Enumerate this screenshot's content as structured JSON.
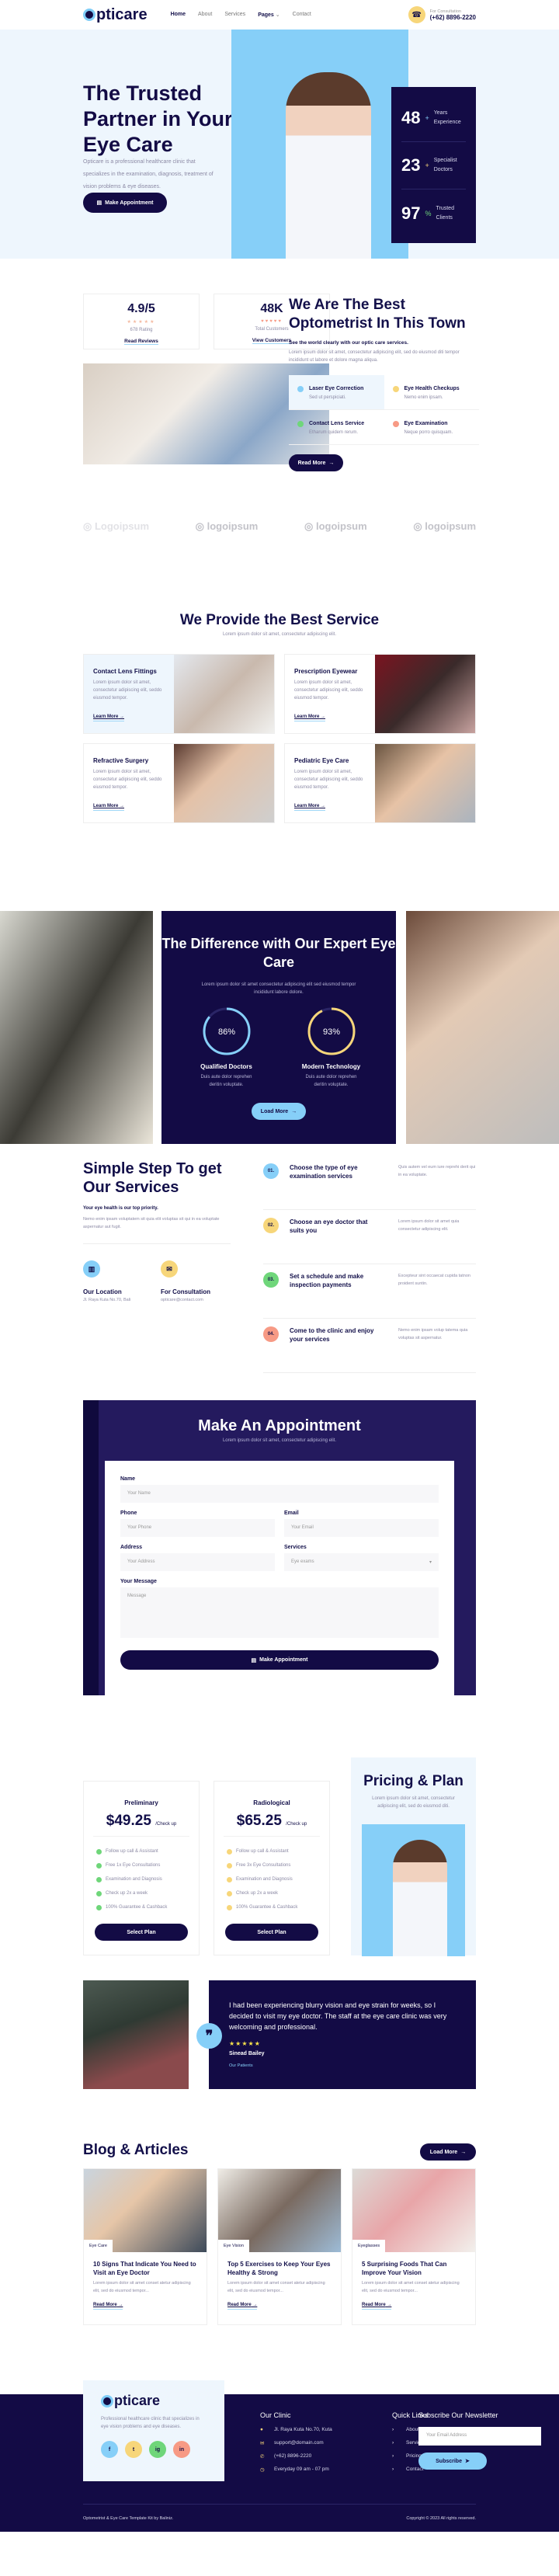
{
  "brand": {
    "logo": "pticare",
    "colors": {
      "navy": "#130b45",
      "sky": "#86cff8",
      "yellow": "#f7d67a",
      "green": "#6fd67a",
      "coral": "#f79a85",
      "light": "#eef6fd"
    }
  },
  "nav": {
    "items": [
      "Home",
      "About",
      "Services",
      "Pages",
      "Contact"
    ],
    "consult_label": "For Consultation",
    "phone": "(+62) 8896-2220"
  },
  "hero": {
    "title": "The Trusted Partner in Your Eye Care",
    "description": "Opticare is a professional healthcare clinic that specializes in the examination, diagnosis, treatment of vision problems & eye diseases.",
    "button": "Make Appointment",
    "stats": [
      {
        "value": "48",
        "suffix": "+",
        "label": "Years Experience"
      },
      {
        "value": "23",
        "suffix": "+",
        "label": "Specialist Doctors"
      },
      {
        "value": "97",
        "suffix": "%",
        "label": "Trusted Clients"
      }
    ]
  },
  "about": {
    "cards": [
      {
        "value": "4.9/5",
        "stars": 5,
        "caption": "678 Rating",
        "link": "Read Reviews"
      },
      {
        "value": "48K",
        "stars": 5,
        "caption": "Total Customers",
        "link": "View Customers"
      }
    ],
    "title": "We Are The Best Optometrist In This Town",
    "subtitle": "See the world clearly with our optic care services.",
    "description": "Lorem ipsum dolor sit amet, consectetur adipiscing elit, sed do eiusmod diti tempor incididunt ut labore et dolore magna aliqua.",
    "features": [
      {
        "title": "Laser Eye Correction",
        "text": "Sed ut perspiciati."
      },
      {
        "title": "Eye Health Checkups",
        "text": "Nemo enim ipsam."
      },
      {
        "title": "Contact Lens Service",
        "text": "Etharum quidem rerum."
      },
      {
        "title": "Eye Examination",
        "text": "Neque porro quisquam."
      }
    ],
    "button": "Read More"
  },
  "logos": [
    "Logoipsum",
    "logoipsum",
    "logoipsum",
    "logoipsum"
  ],
  "services": {
    "title": "We Provide the Best Service",
    "subtitle": "Lorem ipsum dolor sit amet, consectetur adipiscing elit.",
    "items": [
      {
        "title": "Contact Lens Fittings",
        "text": "Lorem ipsum dolor sit amet, consectetur adipiscing elit, seddo eiusmod tempor.",
        "link": "Learn More"
      },
      {
        "title": "Prescription Eyewear",
        "text": "Lorem ipsum dolor sit amet, consectetur adipiscing elit, seddo eiusmod tempor.",
        "link": "Learn More"
      },
      {
        "title": "Refractive Surgery",
        "text": "Lorem ipsum dolor sit amet, consectetur adipiscing elit, seddo eiusmod tempor.",
        "link": "Learn More"
      },
      {
        "title": "Pediatric Eye Care",
        "text": "Lorem ipsum dolor sit amet, consectetur adipiscing elit, seddo eiusmod tempor.",
        "link": "Learn More"
      }
    ]
  },
  "difference": {
    "title": "The Difference with Our Expert Eye Care",
    "description": "Lorem ipsum dolor sit amet consectetur adipiscing elit sed eiusmod tempor incididunt labore dolore.",
    "metrics": [
      {
        "percent": 86,
        "label": "86%",
        "title": "Qualified Doctors",
        "text": "Duis aute dolor reprehen deritin voluptate."
      },
      {
        "percent": 93,
        "label": "93%",
        "title": "Modern Technology",
        "text": "Duis aute dolor reprehen deritin voluptate."
      }
    ],
    "button": "Load More"
  },
  "steps": {
    "title": "Simple Step To get Our Services",
    "subtitle": "Your eye health is our top priority.",
    "description": "Nemo enim ipsam voluptatem sit quia elit voluptas sit qui in ea voluptate aspernatur aut fugit.",
    "location": {
      "title": "Our Location",
      "text": "Jl. Raya Kuta No.70, Bali"
    },
    "consult": {
      "title": "For Consultation",
      "text": "opticare@contact.com"
    },
    "items": [
      {
        "num": "01.",
        "title": "Choose the type of eye examination services",
        "text": "Quis autem vel eum iure reprehi derit qui in ea voluptate."
      },
      {
        "num": "02.",
        "title": "Choose an eye doctor that suits you",
        "text": "Lorem ipsum dolor sit amet quia consectetur adipiscing elit."
      },
      {
        "num": "03.",
        "title": "Set a schedule and make inspection payments",
        "text": "Excepteur sint occaecat cupida tatnon proident suntin."
      },
      {
        "num": "04.",
        "title": "Come to the clinic and enjoy your services",
        "text": "Nemo enim ipsam volup tatema quia voluptas sit aspernatur."
      }
    ]
  },
  "appointment": {
    "title": "Make An Appointment",
    "subtitle": "Lorem ipsum dolor sit amet, consectetur adipiscing elit.",
    "fields": {
      "name": {
        "label": "Name",
        "placeholder": "Your Name"
      },
      "phone": {
        "label": "Phone",
        "placeholder": "Your Phone"
      },
      "email": {
        "label": "Email",
        "placeholder": "Your Email"
      },
      "address": {
        "label": "Address",
        "placeholder": "Your Address"
      },
      "services": {
        "label": "Services",
        "value": "Eye exams"
      },
      "message": {
        "label": "Your Message",
        "placeholder": "Message"
      }
    },
    "button": "Make Appointment"
  },
  "pricing": {
    "title": "Pricing & Plan",
    "description": "Lorem ipsum dolor sit amet, consectetur adipiscing elit, sed do eiusmod diti.",
    "plans": [
      {
        "name": "Preliminary",
        "price": "$49.25",
        "unit": "/Check up",
        "features": [
          "Follow up call & Assistant",
          "Free 1x Eye Consultations",
          "Examination and Diagnosis",
          "Check up 2x a week",
          "100% Guarantee & Cashback"
        ],
        "button": "Select Plan"
      },
      {
        "name": "Radiological",
        "price": "$65.25",
        "unit": "/Check up",
        "features": [
          "Follow up call & Assistant",
          "Free 3x Eye Consultations",
          "Examination and Diagnosis",
          "Check up 2x a week",
          "100% Guarantee & Cashback"
        ],
        "button": "Select Plan"
      }
    ]
  },
  "testimonial": {
    "quote": "I had been experiencing blurry vision and eye strain for weeks, so I decided to visit my eye doctor. The staff at the eye care clinic was very welcoming and professional.",
    "rating": 5,
    "name": "Sinead Bailey",
    "role": "Our Patients"
  },
  "blog": {
    "title": "Blog & Articles",
    "button": "Load More",
    "posts": [
      {
        "tag": "Eye Care",
        "title": "10 Signs That Indicate You Need to Visit an Eye Doctor",
        "excerpt": "Lorem ipsum dolor sit amet conset atetur adipiscing elit, sed do eiusmod tempor...",
        "link": "Read More"
      },
      {
        "tag": "Eye Vision",
        "title": "Top 5 Exercises to Keep Your Eyes Healthy & Strong",
        "excerpt": "Lorem ipsum dolor sit amet conset atetur adipiscing elit, sed do eiusmod tempor...",
        "link": "Read More"
      },
      {
        "tag": "Eyeglasses",
        "title": "5 Surprising Foods That Can Improve Your Vision",
        "excerpt": "Lorem ipsum dolor sit amet conset atetur adipiscing elit, sed do eiusmod tempor...",
        "link": "Read More"
      }
    ]
  },
  "footer": {
    "about": "Professional healthcare clinic that specializes in eye vision problems and eye diseases.",
    "socials": [
      "f",
      "t",
      "ig",
      "in"
    ],
    "clinic": {
      "title": "Our Clinic",
      "items": [
        "Jl. Raya Kuta No.70, Kuta",
        "support@domain.com",
        "(+62) 8896-2220",
        "Everyday 09 am - 07 pm"
      ]
    },
    "links": {
      "title": "Quick Links",
      "items": [
        "About",
        "Services",
        "Pricing",
        "Contact"
      ]
    },
    "newsletter": {
      "title": "Subscribe Our Newsletter",
      "placeholder": "Your Email Address",
      "button": "Subscribe"
    },
    "credit": "Optometrist & Eye Care Template Kit by Baliniz.",
    "copyright": "Copyright © 2023 All rights reserved."
  }
}
